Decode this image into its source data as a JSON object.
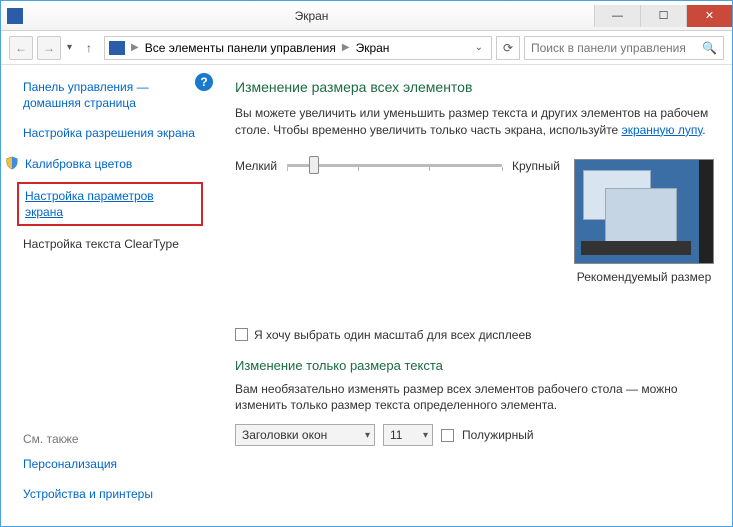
{
  "window": {
    "title": "Экран"
  },
  "nav": {
    "breadcrumb1": "Все элементы панели управления",
    "breadcrumb2": "Экран",
    "search_placeholder": "Поиск в панели управления"
  },
  "sidebar": {
    "home": "Панель управления — домашняя страница",
    "resolution": "Настройка разрешения экрана",
    "calibration": "Калибровка цветов",
    "display_params": "Настройка параметров экрана",
    "cleartype": "Настройка текста ClearType",
    "seealso_heading": "См. также",
    "personalization": "Персонализация",
    "devices": "Устройства и принтеры"
  },
  "main": {
    "heading1": "Изменение размера всех элементов",
    "desc1": "Вы можете увеличить или уменьшить размер текста и других элементов на рабочем столе. Чтобы временно увеличить только часть экрана, используйте ",
    "desc1_link": "экранную лупу",
    "slider_min": "Мелкий",
    "slider_max": "Крупный",
    "preview_caption": "Рекомендуемый размер",
    "chk_label": "Я хочу выбрать один масштаб для всех дисплеев",
    "heading2": "Изменение только размера текста",
    "desc2": "Вам необязательно изменять размер всех элементов рабочего стола — можно изменить только размер текста определенного элемента.",
    "select_element": "Заголовки окон",
    "select_size": "11",
    "bold_label": "Полужирный"
  }
}
